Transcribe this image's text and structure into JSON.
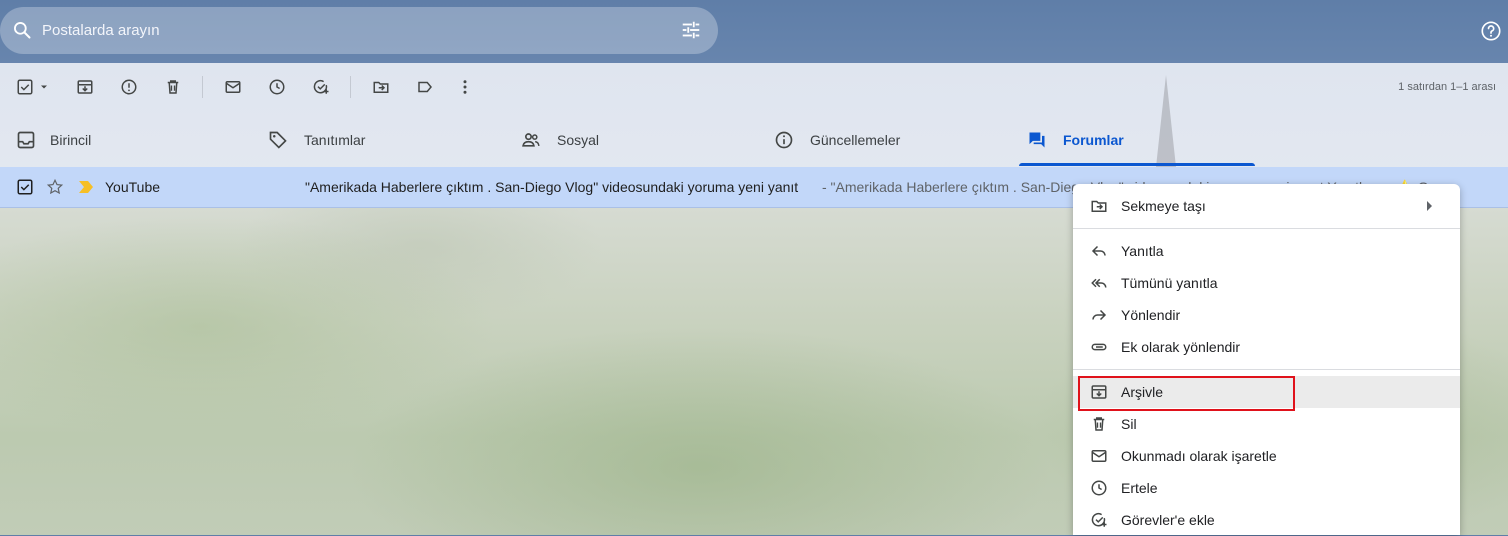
{
  "search": {
    "placeholder": "Postalarda arayın",
    "search_icon": "search-icon",
    "filter_icon": "tune-icon"
  },
  "header": {
    "help_icon": "help-icon"
  },
  "toolbar": {
    "buttons": [
      "select-all-checkbox",
      "archive-icon",
      "report-spam-icon",
      "delete-icon",
      "mark-unread-icon",
      "snooze-icon",
      "add-to-tasks-icon",
      "move-to-icon",
      "label-icon",
      "more-icon"
    ],
    "range_text": "1 satırdan 1–1 arası"
  },
  "tabs": [
    {
      "label": "Birincil",
      "icon": "inbox-icon"
    },
    {
      "label": "Tanıtımlar",
      "icon": "tag-icon"
    },
    {
      "label": "Sosyal",
      "icon": "people-icon"
    },
    {
      "label": "Güncellemeler",
      "icon": "info-icon"
    },
    {
      "label": "Forumlar",
      "icon": "forum-icon",
      "active": true
    }
  ],
  "mail_row": {
    "sender": "YouTube",
    "subject": "\"Amerikada Haberlere çıktım . San-Diego Vlog\" videosundaki yoruma yeni yanıt",
    "snippet": " - \"Amerikada Haberlere çıktım . San-Diego Vlog\" videosundaki yoruma yeni yanıt Yanıtlayan ⭐ Gen ...",
    "selected": true,
    "important_color": "#f6bf26"
  },
  "context_menu": {
    "items": [
      {
        "label": "Sekmeye taşı",
        "icon": "move-to-tab-icon",
        "submenu": true
      },
      {
        "label": "Yanıtla",
        "icon": "reply-icon"
      },
      {
        "label": "Tümünü yanıtla",
        "icon": "reply-all-icon"
      },
      {
        "label": "Yönlendir",
        "icon": "forward-icon"
      },
      {
        "label": "Ek olarak yönlendir",
        "icon": "attachment-icon"
      },
      {
        "label": "Arşivle",
        "icon": "archive-icon",
        "highlighted": true
      },
      {
        "label": "Sil",
        "icon": "trash-icon"
      },
      {
        "label": "Okunmadı olarak işaretle",
        "icon": "mail-icon"
      },
      {
        "label": "Ertele",
        "icon": "clock-icon"
      },
      {
        "label": "Görevler'e ekle",
        "icon": "add-task-icon"
      }
    ]
  },
  "colors": {
    "accent": "#0b57d0",
    "selected_row": "#c2d7f9",
    "highlight_box": "#e0121b"
  }
}
